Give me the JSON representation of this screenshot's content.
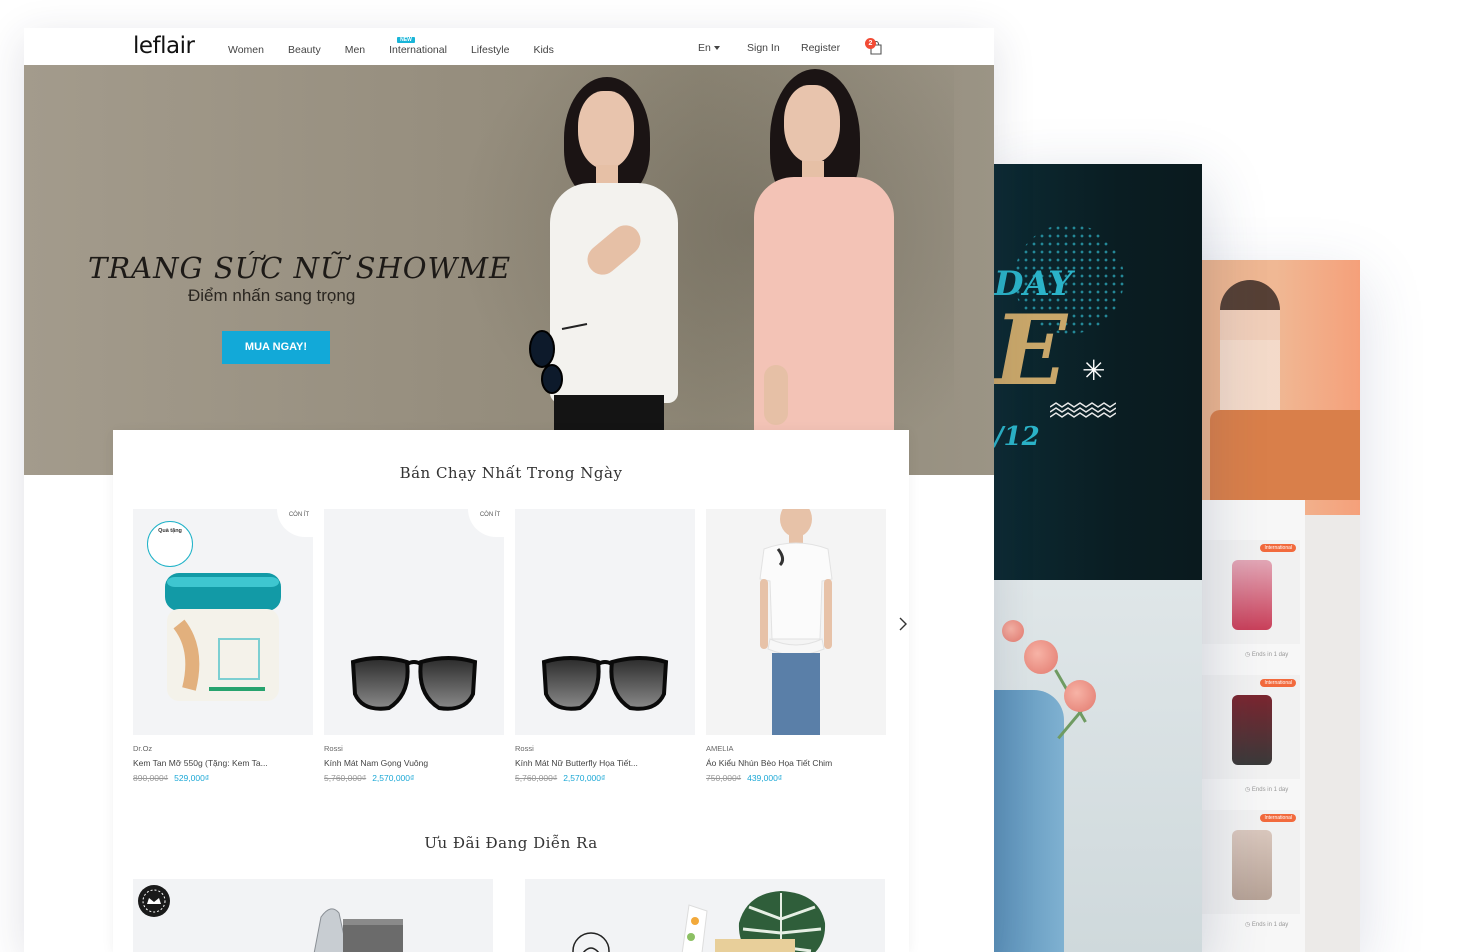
{
  "nav": {
    "logo": "leflair",
    "items": [
      {
        "label": "Women"
      },
      {
        "label": "Beauty"
      },
      {
        "label": "Men"
      },
      {
        "label": "International",
        "badge": "NEW"
      },
      {
        "label": "Lifestyle"
      },
      {
        "label": "Kids"
      }
    ],
    "language": "En",
    "sign_in": "Sign In",
    "register": "Register",
    "cart_count": "2"
  },
  "hero": {
    "title": "TRANG SỨC NỮ SHOWME",
    "subtitle": "Điểm nhấn sang trọng",
    "cta": "MUA NGAY!"
  },
  "bestsellers": {
    "title": "Bán Chạy Nhất Trong Ngày",
    "stock_badge": "CÒN ÍT",
    "gift_badge": "Quà tặng",
    "products": [
      {
        "brand": "Dr.Oz",
        "name": "Kem Tan Mỡ 550g (Tặng: Kem Ta...",
        "old_price": "890,000₫",
        "price": "529,000₫"
      },
      {
        "brand": "Rossi",
        "name": "Kính Mát Nam Gọng Vuông",
        "old_price": "5,760,000₫",
        "price": "2,570,000₫"
      },
      {
        "brand": "Rossi",
        "name": "Kính Mát Nữ Butterfly Họa Tiết...",
        "old_price": "5,760,000₫",
        "price": "2,570,000₫"
      },
      {
        "brand": "AMELIA",
        "name": "Áo Kiểu Nhún Bèo Họa Tiết Chim",
        "old_price": "750,000₫",
        "price": "439,000₫"
      }
    ],
    "next_icon": "chevron-right-icon"
  },
  "offers": {
    "title": "Ưu Đãi Đang Diễn Ra"
  },
  "preview_screens": {
    "sale_text_top": "DAY",
    "sale_text_mid": "E",
    "sale_text_date": "/12",
    "international_badge": "International",
    "ends_label": "Ends in 1 day"
  },
  "colors": {
    "accent": "#12a9d8",
    "price": "#1ca8d6",
    "cart_badge": "#f24b35",
    "new_badge": "#19b5d8"
  }
}
